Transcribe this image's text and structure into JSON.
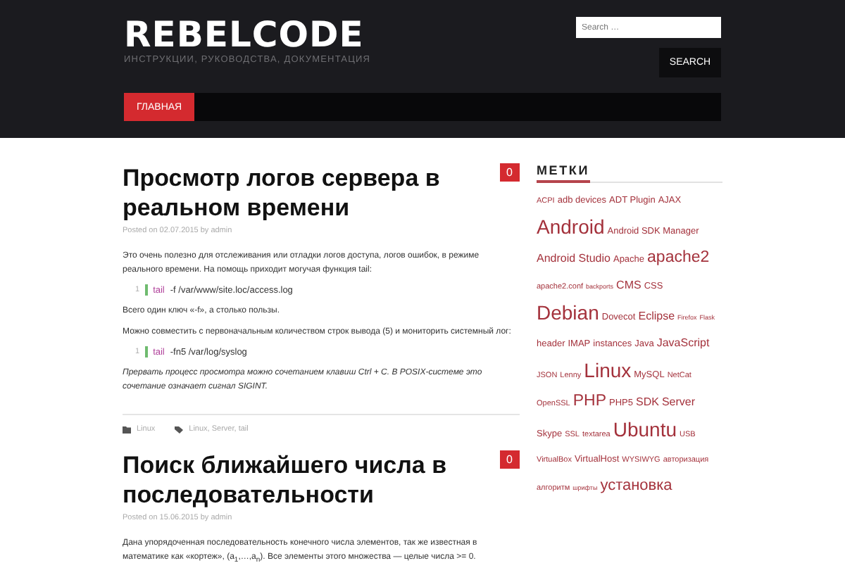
{
  "site": {
    "title": "REBELCODE",
    "tagline": "ИНСТРУКЦИИ, РУКОВОДСТВА, ДОКУМЕНТАЦИЯ"
  },
  "search": {
    "placeholder": "Search …",
    "button": "SEARCH"
  },
  "nav": [
    {
      "label": "ГЛАВНАЯ",
      "selected": true
    }
  ],
  "posts": [
    {
      "title": "Просмотр логов сервера в реальном времени",
      "comments": "0",
      "meta": "Posted on 02.07.2015 by admin",
      "blocks": [
        {
          "kind": "text",
          "text": "Это очень полезно для отслеживания или отладки логов доступа, логов ошибок, в режиме реального времени. На помощь приходит могучая функция tail:"
        },
        {
          "kind": "code",
          "number": "1",
          "command": "tail",
          "args": "-f /var/www/site.loc/access.log"
        },
        {
          "kind": "text",
          "text": "Всего один ключ «-f», а столько пользы."
        },
        {
          "kind": "text",
          "text": "Можно совместить с первоначальным количеством строк вывода (5) и мониторить системный лог:"
        },
        {
          "kind": "code",
          "number": "1",
          "command": "tail",
          "args": "-fn5 /var/log/syslog"
        },
        {
          "kind": "note",
          "text": "Прервать процесс просмотра можно сочетанием клавиш Ctrl + C. В POSIX-системе это сочетание означает сигнал SIGINT."
        }
      ],
      "category": "Linux",
      "tags": "Linux, Server, tail"
    },
    {
      "title": "Поиск ближайшего числа в последовательности",
      "comments": "0",
      "meta": "Posted on 15.06.2015 by admin",
      "blocks": [
        {
          "kind": "text",
          "text": "Дана упорядоченная последовательность конечного числа элементов, так же известная в математике как «кортеж», (a$_{1}$,…,a$_{n}$). Все элементы этого множества — целые числа >= 0."
        }
      ]
    }
  ],
  "sidebar": {
    "heading": "МЕТКИ",
    "tags": [
      {
        "label": "ACPI",
        "kind": "xs"
      },
      {
        "label": "adb devices",
        "kind": "s"
      },
      {
        "label": "ADT Plugin",
        "kind": "s"
      },
      {
        "label": "AJAX",
        "kind": "s"
      },
      {
        "label": "Android",
        "kind": "xl"
      },
      {
        "label": "Android SDK Manager",
        "kind": "s"
      },
      {
        "label": "Android Studio",
        "kind": "m"
      },
      {
        "label": "Apache",
        "kind": "s"
      },
      {
        "label": "apache2",
        "kind": "l"
      },
      {
        "label": "apache2.conf",
        "kind": "xs"
      },
      {
        "label": "backports",
        "kind": "xxs"
      },
      {
        "label": "CMS",
        "kind": "m"
      },
      {
        "label": "CSS",
        "kind": "s"
      },
      {
        "label": "Debian",
        "kind": "xl"
      },
      {
        "label": "Dovecot",
        "kind": "s"
      },
      {
        "label": "Eclipse",
        "kind": "m"
      },
      {
        "label": "Firefox",
        "kind": "xxs"
      },
      {
        "label": "Flask",
        "kind": "xxs"
      },
      {
        "label": "header",
        "kind": "s"
      },
      {
        "label": "IMAP",
        "kind": "s"
      },
      {
        "label": "instances",
        "kind": "s"
      },
      {
        "label": "Java",
        "kind": "s"
      },
      {
        "label": "JavaScript",
        "kind": "m"
      },
      {
        "label": "JSON",
        "kind": "xs"
      },
      {
        "label": "Lenny",
        "kind": "xs"
      },
      {
        "label": "Linux",
        "kind": "xl"
      },
      {
        "label": "MySQL",
        "kind": "s"
      },
      {
        "label": "NetCat",
        "kind": "xs"
      },
      {
        "label": "OpenSSL",
        "kind": "xs"
      },
      {
        "label": "PHP",
        "kind": "l"
      },
      {
        "label": "PHP5",
        "kind": "s"
      },
      {
        "label": "SDK",
        "kind": "m"
      },
      {
        "label": "Server",
        "kind": "m"
      },
      {
        "label": "Skype",
        "kind": "s"
      },
      {
        "label": "SSL",
        "kind": "xs"
      },
      {
        "label": "textarea",
        "kind": "xs"
      },
      {
        "label": "Ubuntu",
        "kind": "xl"
      },
      {
        "label": "USB",
        "kind": "xs"
      },
      {
        "label": "VirtualBox",
        "kind": "xs"
      },
      {
        "label": "VirtualHost",
        "kind": "s"
      },
      {
        "label": "WYSIWYG",
        "kind": "xs"
      },
      {
        "label": "авторизация",
        "kind": "xs"
      },
      {
        "label": "алгоритм",
        "kind": "xs"
      },
      {
        "label": "шрифты",
        "kind": "xxs"
      },
      {
        "label": "установка",
        "kind": "m2"
      }
    ]
  }
}
